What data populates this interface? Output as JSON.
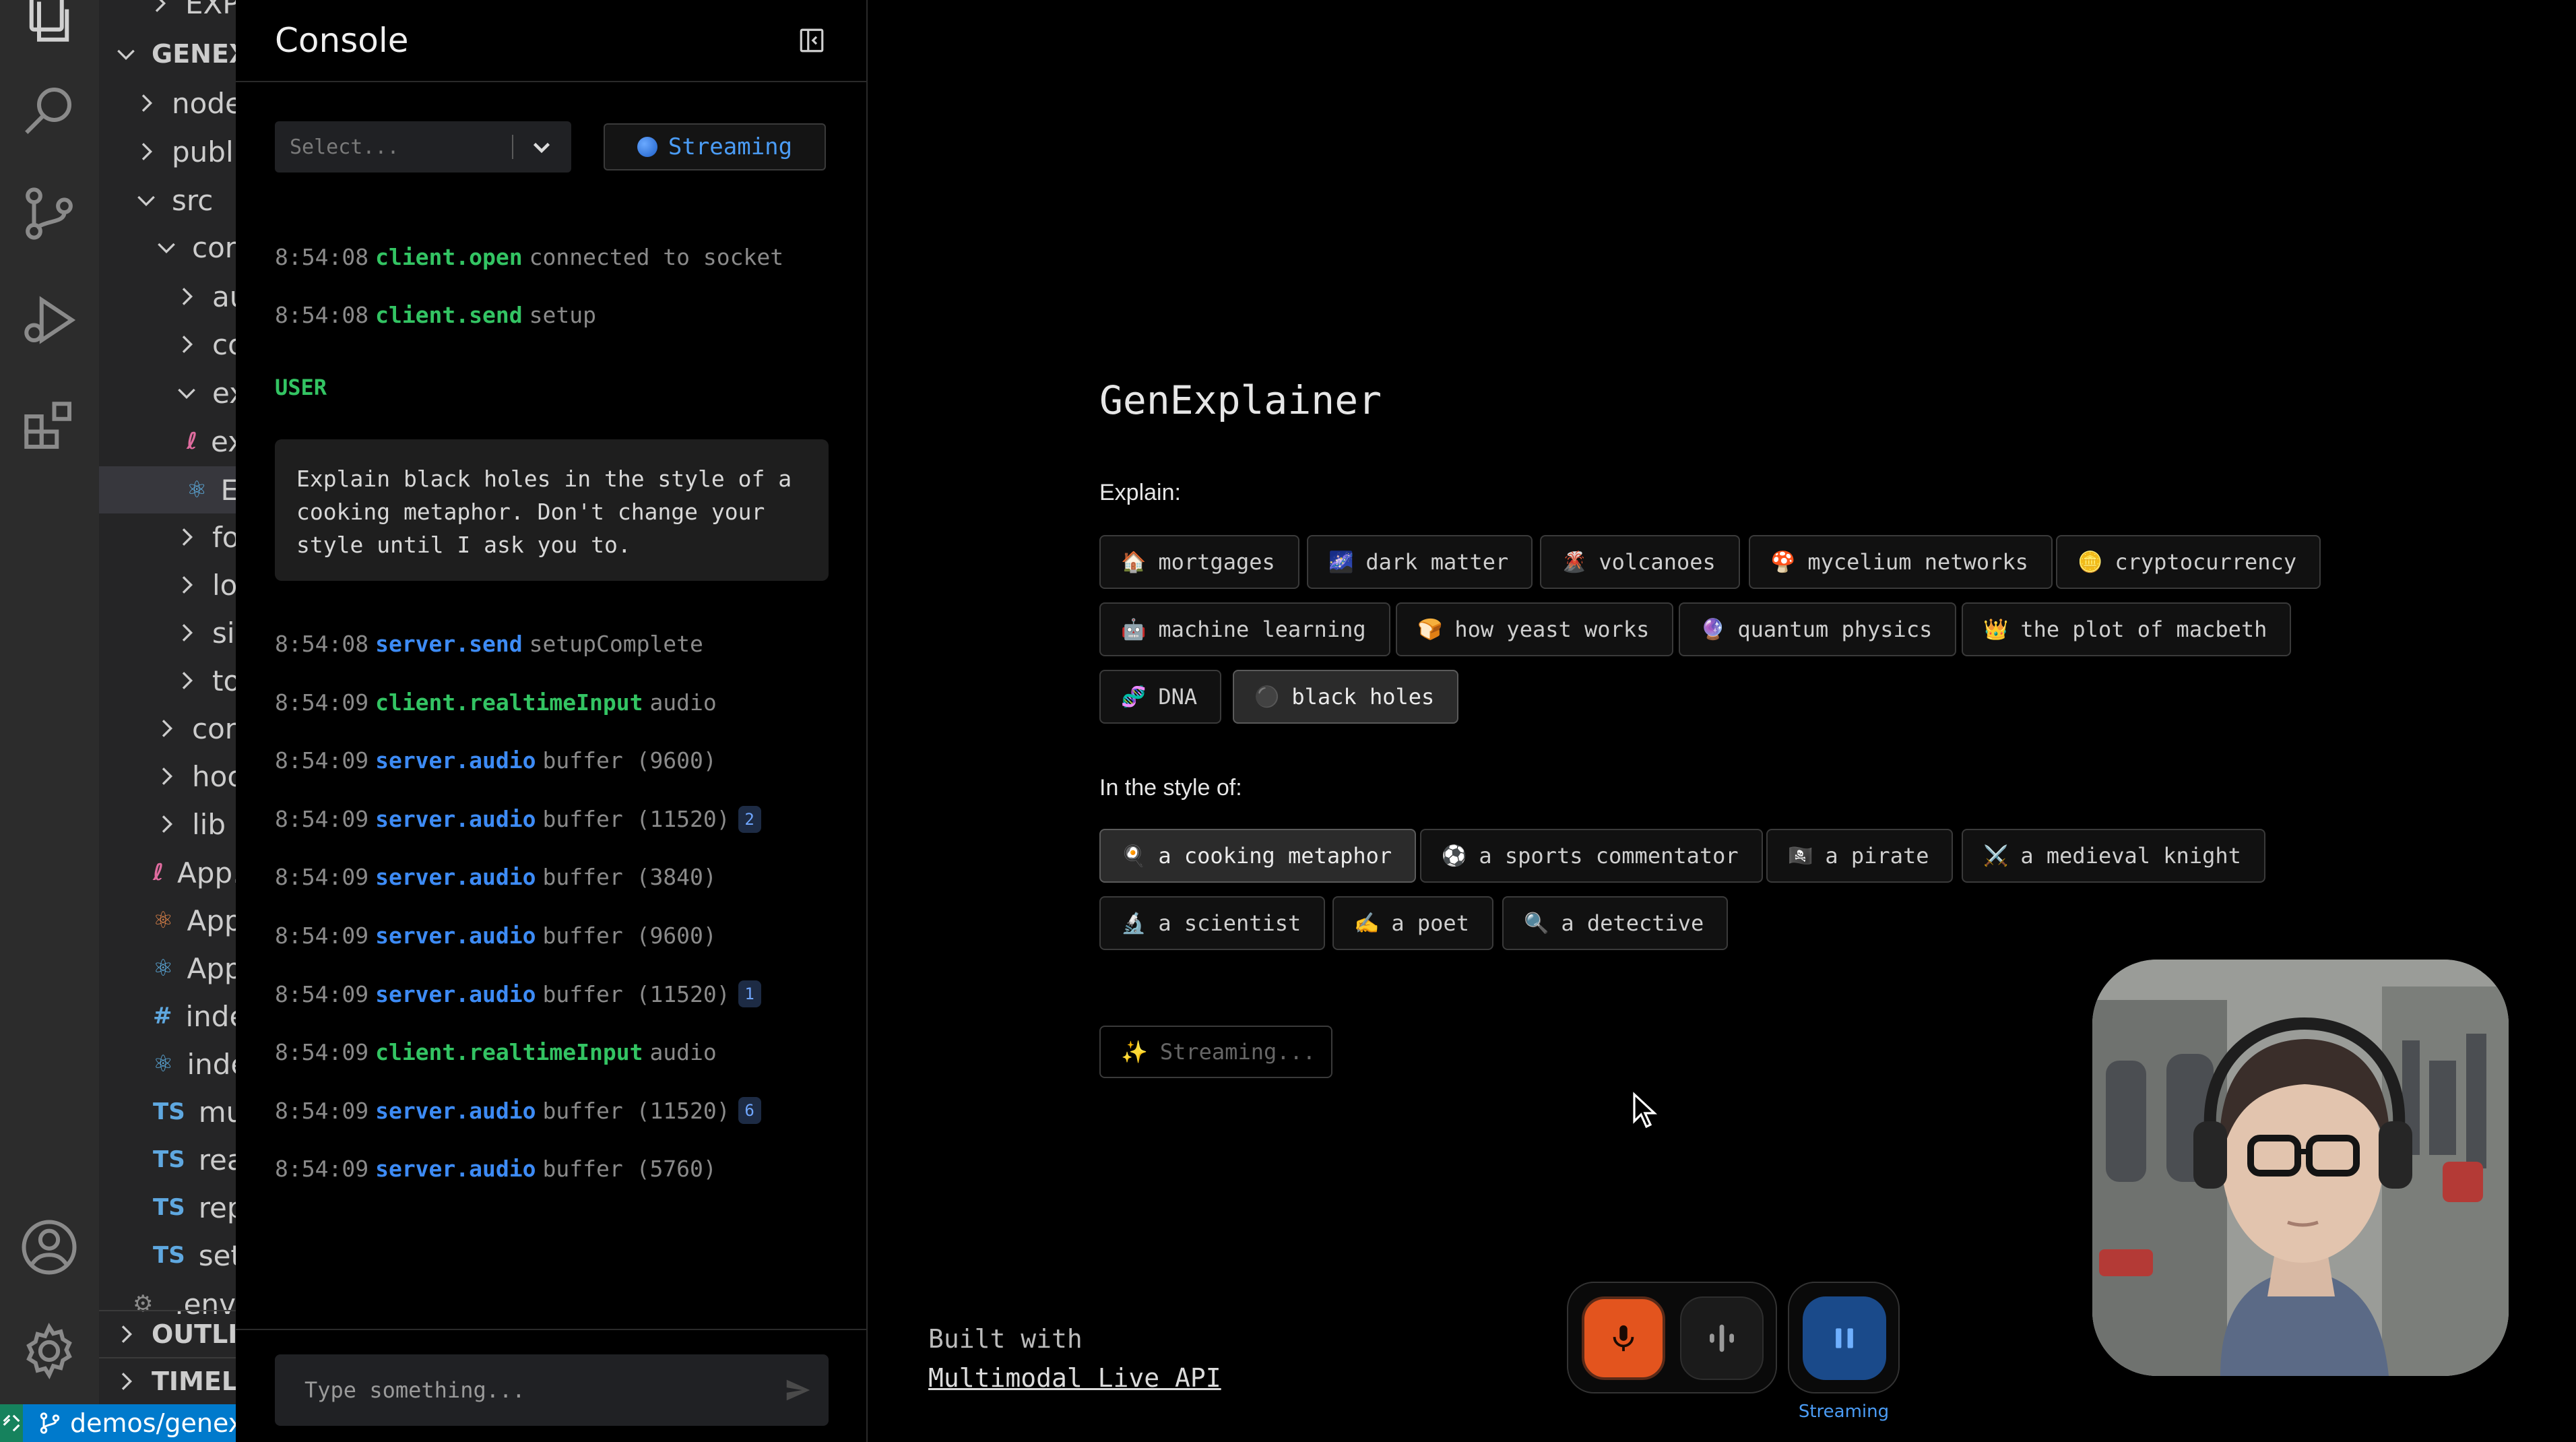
{
  "explorer": {
    "rows": [
      {
        "label": "EXPLOR",
        "kind": "cut"
      },
      {
        "label": "GENEXPLAINER",
        "kind": "root"
      },
      {
        "label": "node_modules",
        "kind": "folder"
      },
      {
        "label": "public",
        "kind": "folder"
      },
      {
        "label": "src",
        "kind": "folder-open"
      },
      {
        "label": "components",
        "kind": "folder-open"
      },
      {
        "label": "audio-pulse",
        "kind": "folder"
      },
      {
        "label": "control-tray",
        "kind": "folder"
      },
      {
        "label": "explainer",
        "kind": "folder-open"
      },
      {
        "label": "explainer.scss",
        "kind": "file-scss"
      },
      {
        "label": "Explainer.tsx",
        "kind": "file-react"
      },
      {
        "label": "footer",
        "kind": "folder"
      },
      {
        "label": "logger",
        "kind": "folder"
      },
      {
        "label": "side-panel",
        "kind": "folder"
      },
      {
        "label": "tools",
        "kind": "folder"
      },
      {
        "label": "contexts",
        "kind": "folder"
      },
      {
        "label": "hooks",
        "kind": "folder"
      },
      {
        "label": "lib",
        "kind": "folder"
      },
      {
        "label": "App.scss",
        "kind": "file-scss"
      },
      {
        "label": "App.test.tsx",
        "kind": "file-react-orange"
      },
      {
        "label": "App.tsx",
        "kind": "file-react"
      },
      {
        "label": "index.css",
        "kind": "file-css"
      },
      {
        "label": "index.tsx",
        "kind": "file-react"
      },
      {
        "label": "multimodal-live-types.ts",
        "kind": "file-ts"
      },
      {
        "label": "react-app-env.d.ts",
        "kind": "file-ts"
      },
      {
        "label": "reportWebVitals.ts",
        "kind": "file-ts"
      },
      {
        "label": "setupTests.ts",
        "kind": "file-ts"
      },
      {
        "label": ".env",
        "kind": "file-gear"
      }
    ],
    "outline": "OUTLINE",
    "timeline": "TIMELINE"
  },
  "statusbar": {
    "branch": "demos/genexplainer"
  },
  "console": {
    "title": "Console",
    "filter_placeholder": "Select...",
    "streaming_button": "Streaming",
    "logs_before": [
      {
        "time": "8:54:08",
        "source": "client.open",
        "color": "green",
        "message": "connected to socket"
      },
      {
        "time": "8:54:08",
        "source": "client.send",
        "color": "green",
        "message": "setup"
      }
    ],
    "user_label": "USER",
    "user_message": "Explain black holes in the style of a cooking metaphor. Don't change your style until I ask you to.",
    "logs_after": [
      {
        "time": "8:54:08",
        "source": "server.send",
        "color": "blue",
        "message": "setupComplete",
        "count": ""
      },
      {
        "time": "8:54:09",
        "source": "client.realtimeInput",
        "color": "green",
        "message": "audio",
        "count": ""
      },
      {
        "time": "8:54:09",
        "source": "server.audio",
        "color": "blue",
        "message": "buffer (9600)",
        "count": ""
      },
      {
        "time": "8:54:09",
        "source": "server.audio",
        "color": "blue",
        "message": "buffer (11520)",
        "count": "2"
      },
      {
        "time": "8:54:09",
        "source": "server.audio",
        "color": "blue",
        "message": "buffer (3840)",
        "count": ""
      },
      {
        "time": "8:54:09",
        "source": "server.audio",
        "color": "blue",
        "message": "buffer (9600)",
        "count": ""
      },
      {
        "time": "8:54:09",
        "source": "server.audio",
        "color": "blue",
        "message": "buffer (11520)",
        "count": "1"
      },
      {
        "time": "8:54:09",
        "source": "client.realtimeInput",
        "color": "green",
        "message": "audio",
        "count": ""
      },
      {
        "time": "8:54:09",
        "source": "server.audio",
        "color": "blue",
        "message": "buffer (11520)",
        "count": "6"
      },
      {
        "time": "8:54:09",
        "source": "server.audio",
        "color": "blue",
        "message": "buffer (5760)",
        "count": ""
      }
    ],
    "input_placeholder": "Type something..."
  },
  "main": {
    "title": "GenExplainer",
    "explain_label": "Explain:",
    "topics": [
      {
        "emoji": "🏠",
        "label": "mortgages",
        "selected": false
      },
      {
        "emoji": "🌌",
        "label": "dark matter",
        "selected": false
      },
      {
        "emoji": "🌋",
        "label": "volcanoes",
        "selected": false
      },
      {
        "emoji": "🍄",
        "label": "mycelium networks",
        "selected": false
      },
      {
        "emoji": "🪙",
        "label": "cryptocurrency",
        "selected": false
      },
      {
        "emoji": "🤖",
        "label": "machine learning",
        "selected": false
      },
      {
        "emoji": "🍞",
        "label": "how yeast works",
        "selected": false
      },
      {
        "emoji": "🔮",
        "label": "quantum physics",
        "selected": false
      },
      {
        "emoji": "👑",
        "label": "the plot of macbeth",
        "selected": false
      },
      {
        "emoji": "🧬",
        "label": "DNA",
        "selected": false
      },
      {
        "emoji": "⚫",
        "label": "black holes",
        "selected": true
      }
    ],
    "style_label": "In the style of:",
    "styles": [
      {
        "emoji": "🍳",
        "label": "a cooking metaphor",
        "selected": true
      },
      {
        "emoji": "⚽",
        "label": "a sports commentator",
        "selected": false
      },
      {
        "emoji": "🏴‍☠️",
        "label": "a pirate",
        "selected": false
      },
      {
        "emoji": "⚔️",
        "label": "a medieval knight",
        "selected": false
      },
      {
        "emoji": "🔬",
        "label": "a scientist",
        "selected": false
      },
      {
        "emoji": "✍️",
        "label": "a poet",
        "selected": false
      },
      {
        "emoji": "🔍",
        "label": "a detective",
        "selected": false
      }
    ],
    "streaming_status": "Streaming...",
    "built_with": "Built with",
    "built_link": "Multimodal Live API",
    "connect_label": "Streaming"
  },
  "colors": {
    "accent_blue": "#3d8bf5",
    "accent_green": "#33c463",
    "mic_orange": "#e3541e"
  },
  "icons": [
    "explorer-icon",
    "search-icon",
    "source-control-icon",
    "run-debug-icon",
    "extensions-icon",
    "account-icon",
    "settings-icon",
    "mic-icon",
    "audio-wave-icon",
    "pause-icon",
    "send-icon",
    "sidebar-toggle-icon",
    "chevron-down-icon"
  ]
}
